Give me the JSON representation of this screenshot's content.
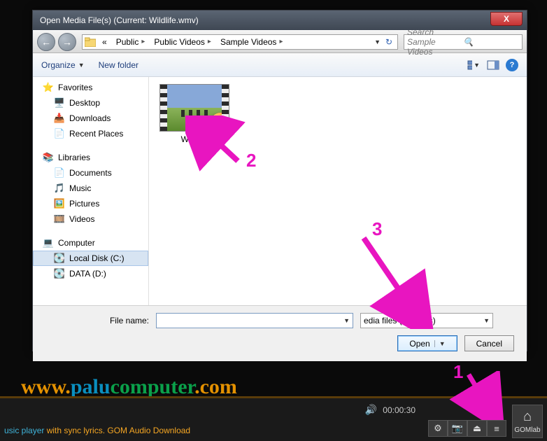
{
  "dialog": {
    "title": "Open Media File(s) (Current: Wildlife.wmv)",
    "close": "X"
  },
  "breadcrumb": {
    "prefix": "«",
    "segments": [
      "Public",
      "Public Videos",
      "Sample Videos"
    ]
  },
  "search": {
    "placeholder": "Search Sample Videos"
  },
  "toolbar": {
    "organize": "Organize",
    "newfolder": "New folder"
  },
  "sidebar": {
    "favorites": {
      "label": "Favorites",
      "items": [
        "Desktop",
        "Downloads",
        "Recent Places"
      ]
    },
    "libraries": {
      "label": "Libraries",
      "items": [
        "Documents",
        "Music",
        "Pictures",
        "Videos"
      ]
    },
    "computer": {
      "label": "Computer",
      "items": [
        "Local Disk (C:)",
        "DATA (D:)"
      ]
    }
  },
  "content": {
    "files": [
      {
        "name": "Wildlife"
      }
    ]
  },
  "footer": {
    "filename_label": "File name:",
    "filename_value": "",
    "filter": "edia files (all types)",
    "open": "Open",
    "cancel": "Cancel"
  },
  "watermark": {
    "w1": "www.",
    "w2": "palu",
    "w3": "computer",
    "w4": ".com"
  },
  "player": {
    "time": "00:00:30",
    "homelabel": "GOMlab"
  },
  "ticker": {
    "blue": "usic player",
    "rest": " with sync lyrics. GOM Audio Download"
  },
  "annotations": {
    "a1": "1",
    "a2": "2",
    "a3": "3"
  }
}
